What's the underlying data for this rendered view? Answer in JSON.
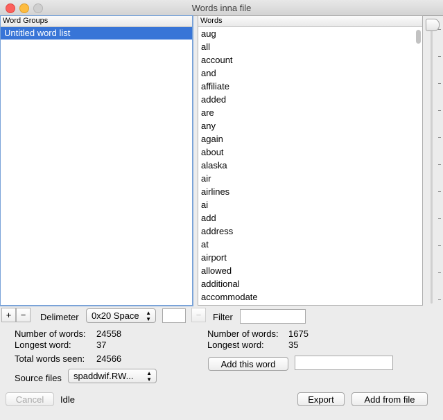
{
  "window": {
    "title": "Words inna file"
  },
  "groups": {
    "header": "Word Groups",
    "items": [
      "Untitled word list"
    ]
  },
  "words": {
    "header": "Words",
    "items": [
      "aug",
      "all",
      "account",
      "and",
      "affiliate",
      "added",
      "are",
      "any",
      "again",
      "about",
      "alaska",
      "air",
      "airlines",
      "ai",
      "add",
      "address",
      "at",
      "airport",
      "allowed",
      "additional",
      "accommodate"
    ]
  },
  "left_controls": {
    "add_label": "+",
    "remove_label": "−",
    "delimiter_label": "Delimeter",
    "delimiter_value": "0x20 Space",
    "delimiter_custom": "",
    "stats": {
      "num_words_label": "Number of words:",
      "num_words_value": "24558",
      "longest_label": "Longest word:",
      "longest_value": "37",
      "total_label": "Total words seen:",
      "total_value": "24566"
    },
    "source_label": "Source files",
    "source_value": "spaddwif.RW..."
  },
  "right_controls": {
    "remove_label": "−",
    "filter_label": "Filter",
    "filter_value": "",
    "stats": {
      "num_words_label": "Number of words:",
      "num_words_value": "1675",
      "longest_label": "Longest word:",
      "longest_value": "35"
    },
    "add_word_label": "Add this word",
    "add_word_value": ""
  },
  "footer": {
    "cancel_label": "Cancel",
    "status": "Idle",
    "export_label": "Export",
    "add_from_file_label": "Add from file"
  }
}
